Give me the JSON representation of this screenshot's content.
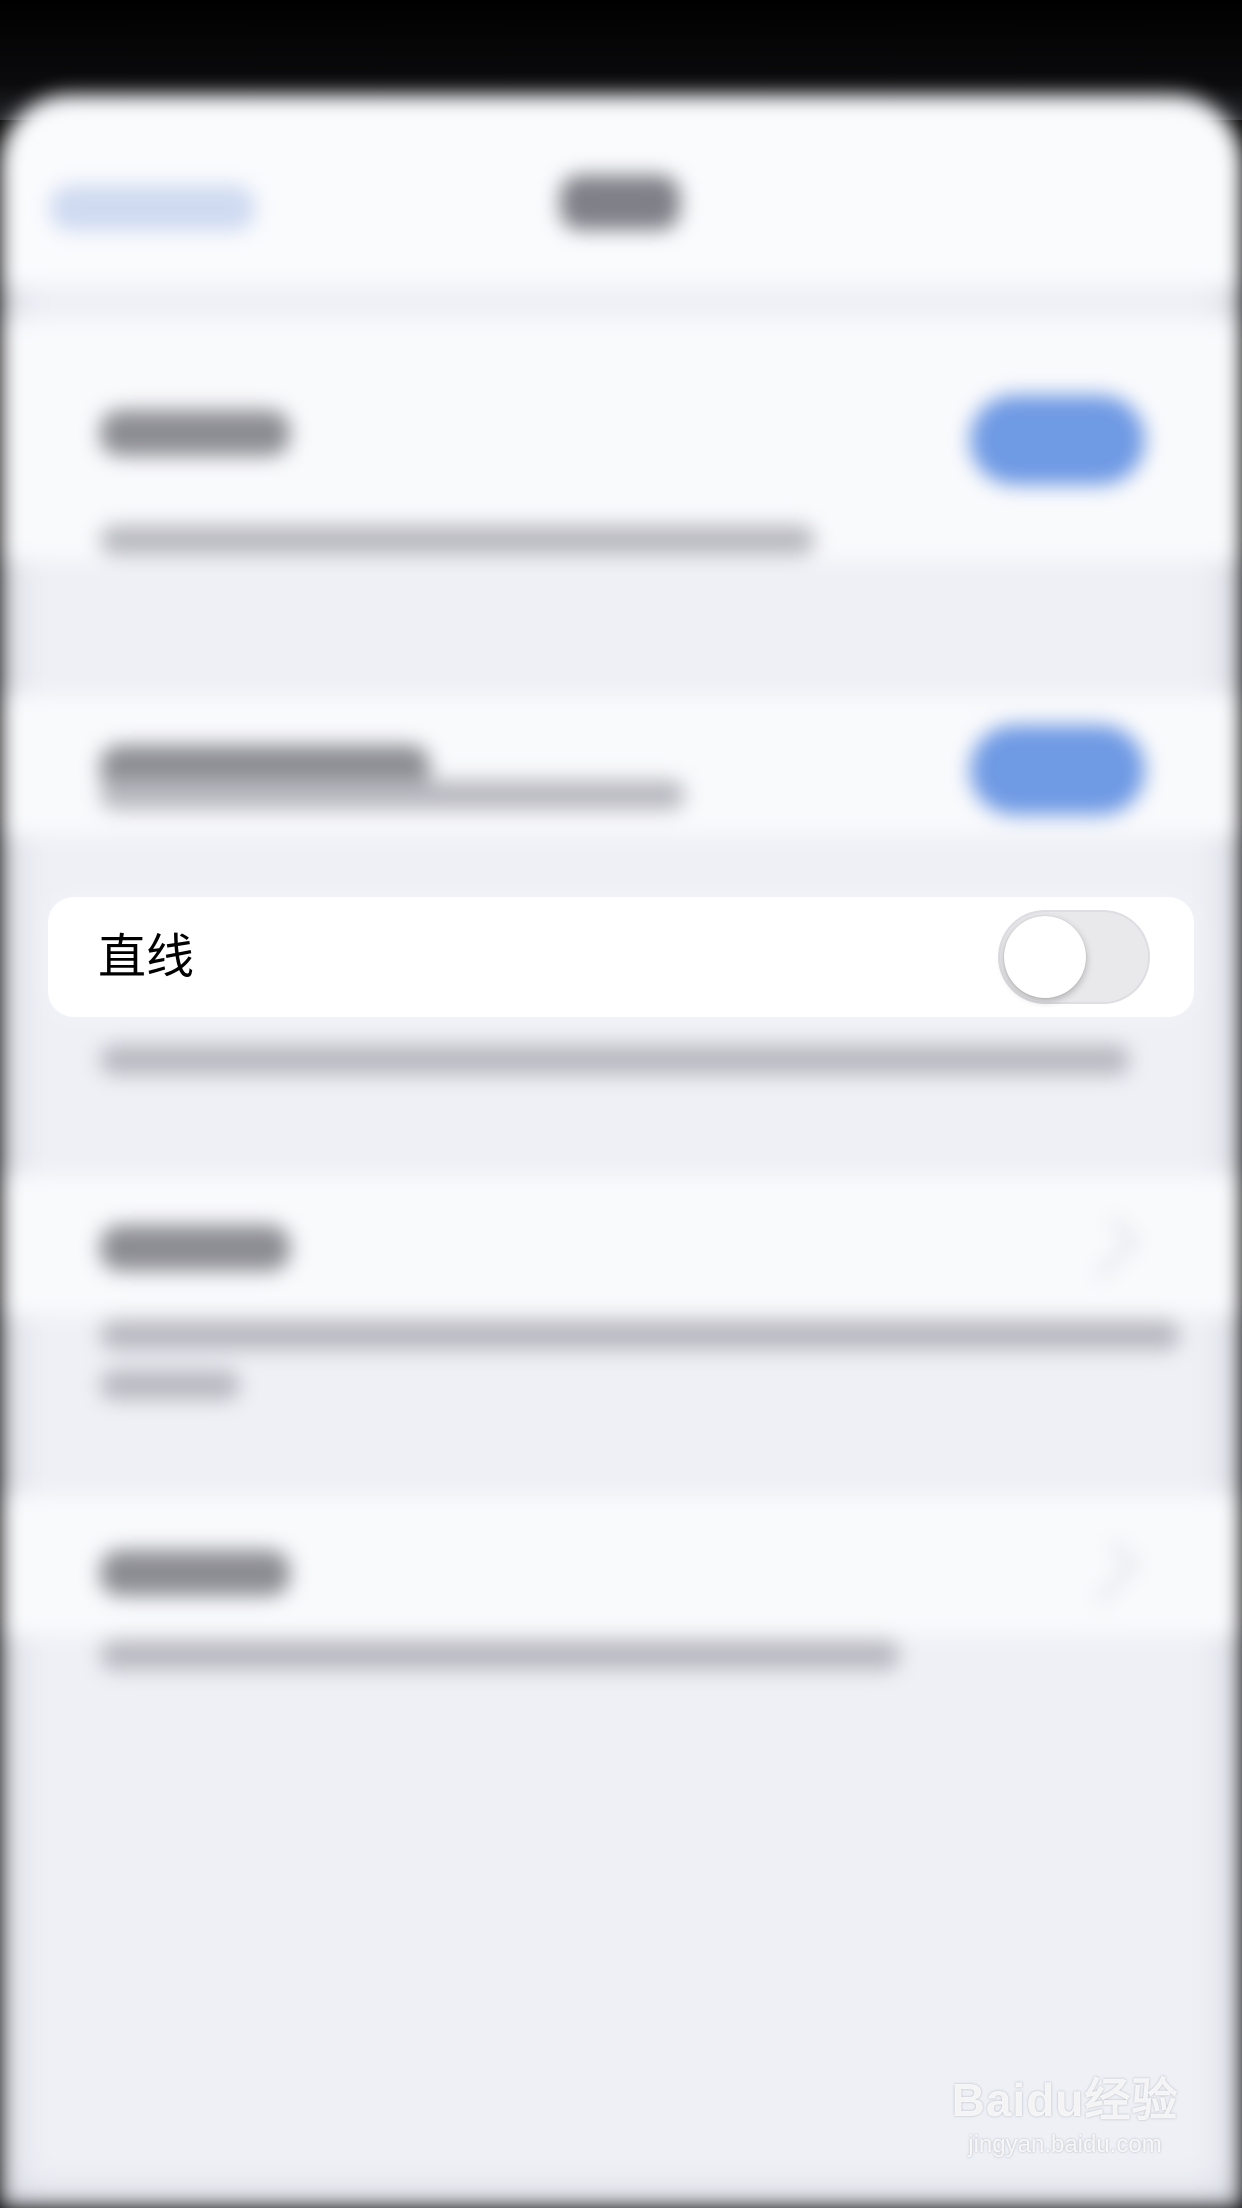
{
  "focus_item": {
    "label": "直线",
    "toggle_on": false
  },
  "colors": {
    "toggle_off_track": "#e9e9eb",
    "toggle_on_track_blurred": "#6f9ae4",
    "background_sheet": "#eef0f6"
  },
  "watermark": {
    "logo": "Baidu经验",
    "url": "jingyan.baidu.com"
  }
}
